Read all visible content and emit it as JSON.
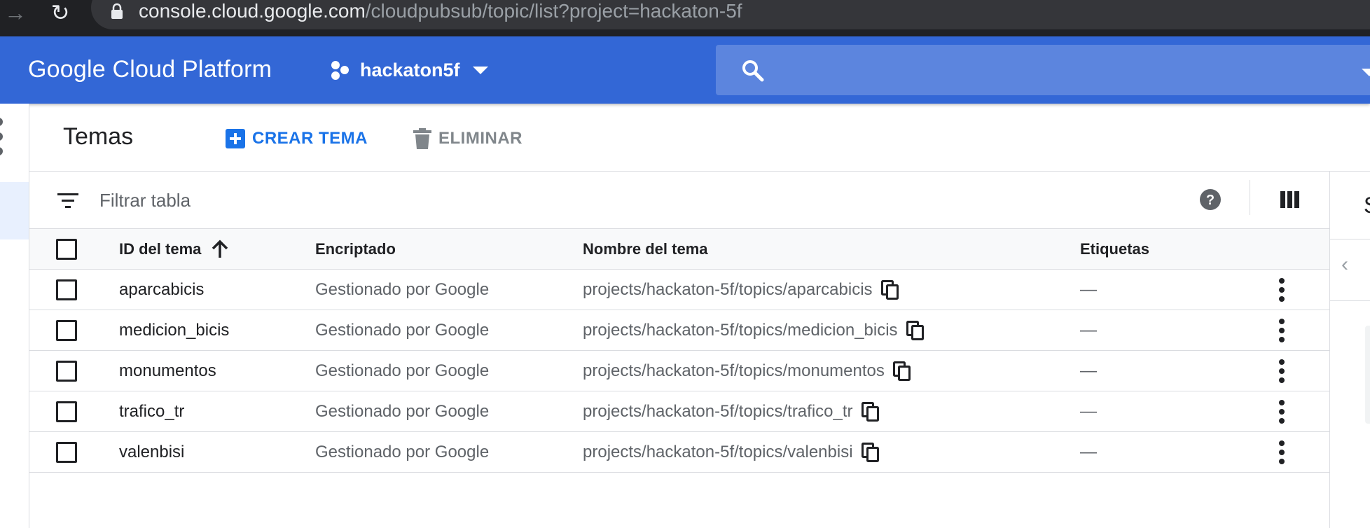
{
  "browser": {
    "url_host": "console.cloud.google.com",
    "url_path": "/cloudpubsub/topic/list?project=hackaton-5f"
  },
  "header": {
    "brand": "Google Cloud Platform",
    "project_name": "hackaton5f",
    "accent_color": "#3367d6"
  },
  "toolbar": {
    "title": "Temas",
    "create_label": "CREAR TEMA",
    "delete_label": "ELIMINAR"
  },
  "filter": {
    "placeholder": "Filtrar tabla"
  },
  "table": {
    "columns": {
      "id": "ID del tema",
      "encryption": "Encriptado",
      "name": "Nombre del tema",
      "labels": "Etiquetas"
    },
    "sort": "ascending",
    "rows": [
      {
        "id": "aparcabicis",
        "encryption": "Gestionado por Google",
        "name": "projects/hackaton-5f/topics/aparcabicis",
        "labels": "—"
      },
      {
        "id": "medicion_bicis",
        "encryption": "Gestionado por Google",
        "name": "projects/hackaton-5f/topics/medicion_bicis",
        "labels": "—"
      },
      {
        "id": "monumentos",
        "encryption": "Gestionado por Google",
        "name": "projects/hackaton-5f/topics/monumentos",
        "labels": "—"
      },
      {
        "id": "trafico_tr",
        "encryption": "Gestionado por Google",
        "name": "projects/hackaton-5f/topics/trafico_tr",
        "labels": "—"
      },
      {
        "id": "valenbisi",
        "encryption": "Gestionado por Google",
        "name": "projects/hackaton-5f/topics/valenbisi",
        "labels": "—"
      }
    ]
  },
  "right_panel": {
    "letter": "S"
  },
  "icons": [
    "arrow-forward-icon",
    "reload-icon",
    "lock-icon",
    "project-icon",
    "search-icon",
    "add-box-icon",
    "trash-icon",
    "filter-icon",
    "help-icon",
    "columns-icon",
    "arrow-upward-icon",
    "copy-icon",
    "more-vert-icon",
    "chevron-left-icon"
  ]
}
